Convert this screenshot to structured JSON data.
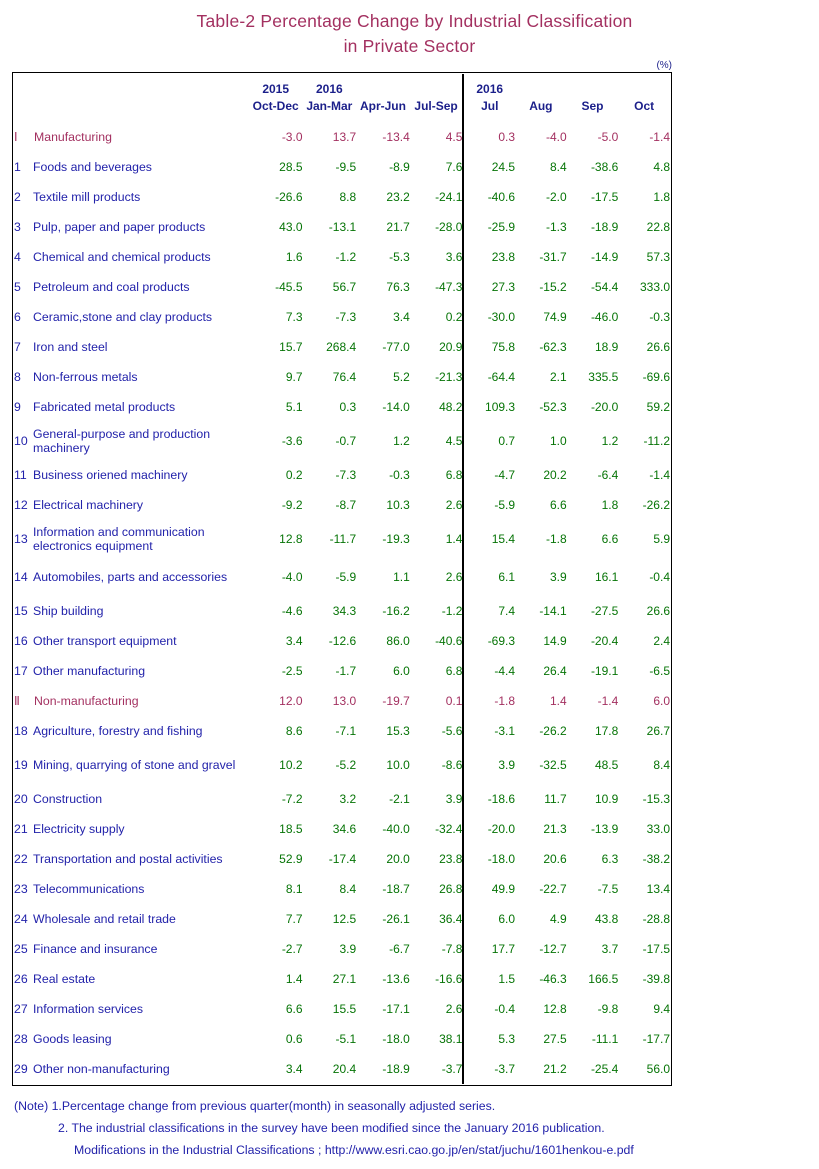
{
  "title": {
    "line1": "Table-2   Percentage Change by Industrial Classification",
    "line2": "in Private Sector"
  },
  "unit_label": "(%)",
  "header": {
    "blank": "",
    "columns": [
      {
        "year": "2015",
        "period": "Oct-Dec",
        "group": "quarter"
      },
      {
        "year": "2016",
        "period": "Jan-Mar",
        "group": "quarter"
      },
      {
        "year": "",
        "period": "Apr-Jun",
        "group": "quarter"
      },
      {
        "year": "",
        "period": "Jul-Sep",
        "group": "quarter"
      },
      {
        "year": "2016",
        "period": "Jul",
        "group": "month"
      },
      {
        "year": "",
        "period": "Aug",
        "group": "month"
      },
      {
        "year": "",
        "period": "Sep",
        "group": "month"
      },
      {
        "year": "",
        "period": "Oct",
        "group": "month"
      }
    ]
  },
  "colors": {
    "title": "#a33060",
    "section": "#a33060",
    "label": "#2222aa",
    "value": "#067406"
  },
  "rows": [
    {
      "kind": "section",
      "no": "Ⅰ",
      "name": "Manufacturing",
      "values": [
        "-3.0",
        "13.7",
        "-13.4",
        "4.5",
        "0.3",
        "-4.0",
        "-5.0",
        "-1.4"
      ]
    },
    {
      "kind": "item",
      "no": "1",
      "name": "Foods and beverages",
      "values": [
        "28.5",
        "-9.5",
        "-8.9",
        "7.6",
        "24.5",
        "8.4",
        "-38.6",
        "4.8"
      ]
    },
    {
      "kind": "item",
      "no": "2",
      "name": "Textile mill products",
      "values": [
        "-26.6",
        "8.8",
        "23.2",
        "-24.1",
        "-40.6",
        "-2.0",
        "-17.5",
        "1.8"
      ]
    },
    {
      "kind": "item",
      "no": "3",
      "name": "Pulp, paper and paper products",
      "values": [
        "43.0",
        "-13.1",
        "21.7",
        "-28.0",
        "-25.9",
        "-1.3",
        "-18.9",
        "22.8"
      ]
    },
    {
      "kind": "item",
      "no": "4",
      "name": "Chemical and chemical products",
      "values": [
        "1.6",
        "-1.2",
        "-5.3",
        "3.6",
        "23.8",
        "-31.7",
        "-14.9",
        "57.3"
      ]
    },
    {
      "kind": "item",
      "no": "5",
      "name": "Petroleum and coal products",
      "values": [
        "-45.5",
        "56.7",
        "76.3",
        "-47.3",
        "27.3",
        "-15.2",
        "-54.4",
        "333.0"
      ]
    },
    {
      "kind": "item",
      "no": "6",
      "name": "Ceramic,stone and clay products",
      "values": [
        "7.3",
        "-7.3",
        "3.4",
        "0.2",
        "-30.0",
        "74.9",
        "-46.0",
        "-0.3"
      ]
    },
    {
      "kind": "item",
      "no": "7",
      "name": "Iron and steel",
      "values": [
        "15.7",
        "268.4",
        "-77.0",
        "20.9",
        "75.8",
        "-62.3",
        "18.9",
        "26.6"
      ]
    },
    {
      "kind": "item",
      "no": "8",
      "name": "Non-ferrous metals",
      "values": [
        "9.7",
        "76.4",
        "5.2",
        "-21.3",
        "-64.4",
        "2.1",
        "335.5",
        "-69.6"
      ]
    },
    {
      "kind": "item",
      "no": "9",
      "name": "Fabricated metal products",
      "values": [
        "5.1",
        "0.3",
        "-14.0",
        "48.2",
        "109.3",
        "-52.3",
        "-20.0",
        "59.2"
      ]
    },
    {
      "kind": "item2",
      "no": "10",
      "name": "General-purpose and production machinery",
      "values": [
        "-3.6",
        "-0.7",
        "1.2",
        "4.5",
        "0.7",
        "1.0",
        "1.2",
        "-11.2"
      ]
    },
    {
      "kind": "item",
      "no": "11",
      "name": "Business oriened machinery",
      "values": [
        "0.2",
        "-7.3",
        "-0.3",
        "6.8",
        "-4.7",
        "20.2",
        "-6.4",
        "-1.4"
      ]
    },
    {
      "kind": "item",
      "no": "12",
      "name": "Electrical machinery",
      "values": [
        "-9.2",
        "-8.7",
        "10.3",
        "2.6",
        "-5.9",
        "6.6",
        "1.8",
        "-26.2"
      ]
    },
    {
      "kind": "item2",
      "no": "13",
      "name": "Information and communication electronics equipment",
      "values": [
        "12.8",
        "-11.7",
        "-19.3",
        "1.4",
        "15.4",
        "-1.8",
        "6.6",
        "5.9"
      ]
    },
    {
      "kind": "item2",
      "no": "14",
      "name": "Automobiles, parts and accessories",
      "values": [
        "-4.0",
        "-5.9",
        "1.1",
        "2.6",
        "6.1",
        "3.9",
        "16.1",
        "-0.4"
      ]
    },
    {
      "kind": "item",
      "no": "15",
      "name": "Ship building",
      "values": [
        "-4.6",
        "34.3",
        "-16.2",
        "-1.2",
        "7.4",
        "-14.1",
        "-27.5",
        "26.6"
      ]
    },
    {
      "kind": "item",
      "no": "16",
      "name": "Other transport equipment",
      "values": [
        "3.4",
        "-12.6",
        "86.0",
        "-40.6",
        "-69.3",
        "14.9",
        "-20.4",
        "2.4"
      ]
    },
    {
      "kind": "item",
      "no": "17",
      "name": "Other manufacturing",
      "values": [
        "-2.5",
        "-1.7",
        "6.0",
        "6.8",
        "-4.4",
        "26.4",
        "-19.1",
        "-6.5"
      ]
    },
    {
      "kind": "section",
      "no": "Ⅱ",
      "name": "Non-manufacturing",
      "values": [
        "12.0",
        "13.0",
        "-19.7",
        "0.1",
        "-1.8",
        "1.4",
        "-1.4",
        "6.0"
      ]
    },
    {
      "kind": "item",
      "no": "18",
      "name": "Agriculture, forestry and fishing",
      "values": [
        "8.6",
        "-7.1",
        "15.3",
        "-5.6",
        "-3.1",
        "-26.2",
        "17.8",
        "26.7"
      ]
    },
    {
      "kind": "item2",
      "no": "19",
      "name": "Mining, quarrying of stone and gravel",
      "values": [
        "10.2",
        "-5.2",
        "10.0",
        "-8.6",
        "3.9",
        "-32.5",
        "48.5",
        "8.4"
      ]
    },
    {
      "kind": "item",
      "no": "20",
      "name": "Construction",
      "values": [
        "-7.2",
        "3.2",
        "-2.1",
        "3.9",
        "-18.6",
        "11.7",
        "10.9",
        "-15.3"
      ]
    },
    {
      "kind": "item",
      "no": "21",
      "name": "Electricity supply",
      "values": [
        "18.5",
        "34.6",
        "-40.0",
        "-32.4",
        "-20.0",
        "21.3",
        "-13.9",
        "33.0"
      ]
    },
    {
      "kind": "item",
      "no": "22",
      "name": "Transportation and postal activities",
      "values": [
        "52.9",
        "-17.4",
        "20.0",
        "23.8",
        "-18.0",
        "20.6",
        "6.3",
        "-38.2"
      ]
    },
    {
      "kind": "item",
      "no": "23",
      "name": "Telecommunications",
      "values": [
        "8.1",
        "8.4",
        "-18.7",
        "26.8",
        "49.9",
        "-22.7",
        "-7.5",
        "13.4"
      ]
    },
    {
      "kind": "item",
      "no": "24",
      "name": "Wholesale and retail trade",
      "values": [
        "7.7",
        "12.5",
        "-26.1",
        "36.4",
        "6.0",
        "4.9",
        "43.8",
        "-28.8"
      ]
    },
    {
      "kind": "item",
      "no": "25",
      "name": "Finance and insurance",
      "values": [
        "-2.7",
        "3.9",
        "-6.7",
        "-7.8",
        "17.7",
        "-12.7",
        "3.7",
        "-17.5"
      ]
    },
    {
      "kind": "item",
      "no": "26",
      "name": "Real estate",
      "values": [
        "1.4",
        "27.1",
        "-13.6",
        "-16.6",
        "1.5",
        "-46.3",
        "166.5",
        "-39.8"
      ]
    },
    {
      "kind": "item",
      "no": "27",
      "name": "Information services",
      "values": [
        "6.6",
        "15.5",
        "-17.1",
        "2.6",
        "-0.4",
        "12.8",
        "-9.8",
        "9.4"
      ]
    },
    {
      "kind": "item",
      "no": "28",
      "name": "Goods leasing",
      "values": [
        "0.6",
        "-5.1",
        "-18.0",
        "38.1",
        "5.3",
        "27.5",
        "-11.1",
        "-17.7"
      ]
    },
    {
      "kind": "item",
      "no": "29",
      "name": "Other non-manufacturing",
      "values": [
        "3.4",
        "20.4",
        "-18.9",
        "-3.7",
        "-3.7",
        "21.2",
        "-25.4",
        "56.0"
      ]
    }
  ],
  "notes": {
    "note1": "(Note) 1.Percentage change from previous quarter(month) in seasonally adjusted series.",
    "note2": "2. The industrial classifications in the survey have been modified since  the January 2016 publication.",
    "note3": "Modifications in the Industrial Classifications ;  http://www.esri.cao.go.jp/en/stat/juchu/1601henkou-e.pdf"
  }
}
